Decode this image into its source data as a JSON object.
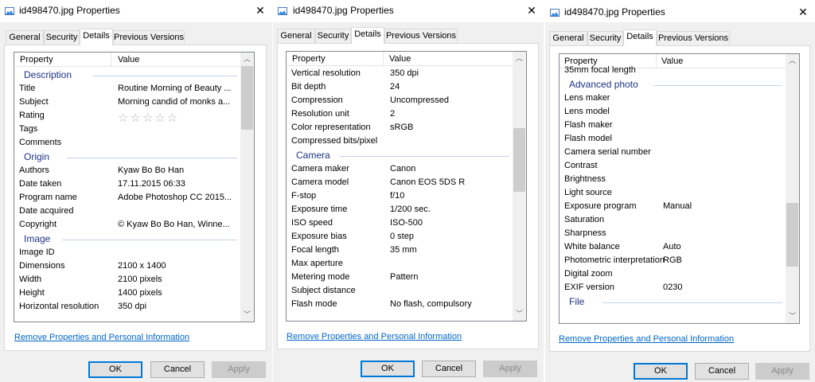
{
  "colors": {
    "accent": "#0078d7",
    "group_header": "#1e3287",
    "link": "#0066cc"
  },
  "icons": {
    "title": "image-file-icon",
    "close": "close-icon",
    "scroll_up": "scroll-up-arrow-icon",
    "scroll_down": "scroll-down-arrow-icon",
    "rating": "star-icon"
  },
  "dialogs": [
    {
      "title": "id498470.jpg Properties",
      "close": "✕",
      "tabs": [
        "General",
        "Security",
        "Details",
        "Previous Versions"
      ],
      "active_tab": "Details",
      "columns": {
        "property": "Property",
        "value": "Value"
      },
      "rows": [
        {
          "group": "Description"
        },
        {
          "p": "Title",
          "v": "Routine Morning of Beauty ..."
        },
        {
          "p": "Subject",
          "v": "Morning candid of monks a..."
        },
        {
          "p": "Rating",
          "v": "☆☆☆☆☆"
        },
        {
          "p": "Tags",
          "v": ""
        },
        {
          "p": "Comments",
          "v": ""
        },
        {
          "group": "Origin"
        },
        {
          "p": "Authors",
          "v": "Kyaw Bo Bo Han"
        },
        {
          "p": "Date taken",
          "v": "17.11.2015 06:33"
        },
        {
          "p": "Program name",
          "v": "Adobe Photoshop CC 2015..."
        },
        {
          "p": "Date acquired",
          "v": ""
        },
        {
          "p": "Copyright",
          "v": "© Kyaw Bo Bo Han, Winne..."
        },
        {
          "group": "Image"
        },
        {
          "p": "Image ID",
          "v": ""
        },
        {
          "p": "Dimensions",
          "v": "2100 x 1400"
        },
        {
          "p": "Width",
          "v": "2100 pixels"
        },
        {
          "p": "Height",
          "v": "1400 pixels"
        },
        {
          "p": "Horizontal resolution",
          "v": "350 dpi"
        }
      ],
      "scroll_position": 0.0,
      "link": "Remove Properties and Personal Information",
      "buttons": {
        "ok": "OK",
        "cancel": "Cancel",
        "apply": "Apply"
      }
    },
    {
      "title": "id498470.jpg Properties",
      "close": "✕",
      "tabs": [
        "General",
        "Security",
        "Details",
        "Previous Versions"
      ],
      "active_tab": "Details",
      "columns": {
        "property": "Property",
        "value": "Value"
      },
      "rows": [
        {
          "p": "Vertical resolution",
          "v": "350 dpi"
        },
        {
          "p": "Bit depth",
          "v": "24"
        },
        {
          "p": "Compression",
          "v": "Uncompressed"
        },
        {
          "p": "Resolution unit",
          "v": "2"
        },
        {
          "p": "Color representation",
          "v": "sRGB"
        },
        {
          "p": "Compressed bits/pixel",
          "v": ""
        },
        {
          "group": "Camera"
        },
        {
          "p": "Camera maker",
          "v": "Canon"
        },
        {
          "p": "Camera model",
          "v": "Canon EOS 5DS R"
        },
        {
          "p": "F-stop",
          "v": "f/10"
        },
        {
          "p": "Exposure time",
          "v": "1/200 sec."
        },
        {
          "p": "ISO speed",
          "v": "ISO-500"
        },
        {
          "p": "Exposure bias",
          "v": "0 step"
        },
        {
          "p": "Focal length",
          "v": "35 mm"
        },
        {
          "p": "Max aperture",
          "v": ""
        },
        {
          "p": "Metering mode",
          "v": "Pattern"
        },
        {
          "p": "Subject distance",
          "v": ""
        },
        {
          "p": "Flash mode",
          "v": "No flash, compulsory"
        }
      ],
      "scroll_position": 0.35,
      "link": "Remove Properties and Personal Information",
      "buttons": {
        "ok": "OK",
        "cancel": "Cancel",
        "apply": "Apply"
      }
    },
    {
      "title": "id498470.jpg Properties",
      "close": "✕",
      "tabs": [
        "General",
        "Security",
        "Details",
        "Previous Versions"
      ],
      "active_tab": "Details",
      "columns": {
        "property": "Property",
        "value": "Value"
      },
      "rows": [
        {
          "p": "35mm focal length",
          "v": ""
        },
        {
          "group": "Advanced photo"
        },
        {
          "p": "Lens maker",
          "v": ""
        },
        {
          "p": "Lens model",
          "v": ""
        },
        {
          "p": "Flash maker",
          "v": ""
        },
        {
          "p": "Flash model",
          "v": ""
        },
        {
          "p": "Camera serial number",
          "v": ""
        },
        {
          "p": "Contrast",
          "v": ""
        },
        {
          "p": "Brightness",
          "v": ""
        },
        {
          "p": "Light source",
          "v": ""
        },
        {
          "p": "Exposure program",
          "v": "Manual"
        },
        {
          "p": "Saturation",
          "v": ""
        },
        {
          "p": "Sharpness",
          "v": ""
        },
        {
          "p": "White balance",
          "v": "Auto"
        },
        {
          "p": "Photometric interpretation",
          "v": "RGB"
        },
        {
          "p": "Digital zoom",
          "v": ""
        },
        {
          "p": "EXIF version",
          "v": "0230"
        },
        {
          "group": "File"
        }
      ],
      "scroll_position": 0.75,
      "link": "Remove Properties and Personal Information",
      "buttons": {
        "ok": "OK",
        "cancel": "Cancel",
        "apply": "Apply"
      }
    }
  ]
}
